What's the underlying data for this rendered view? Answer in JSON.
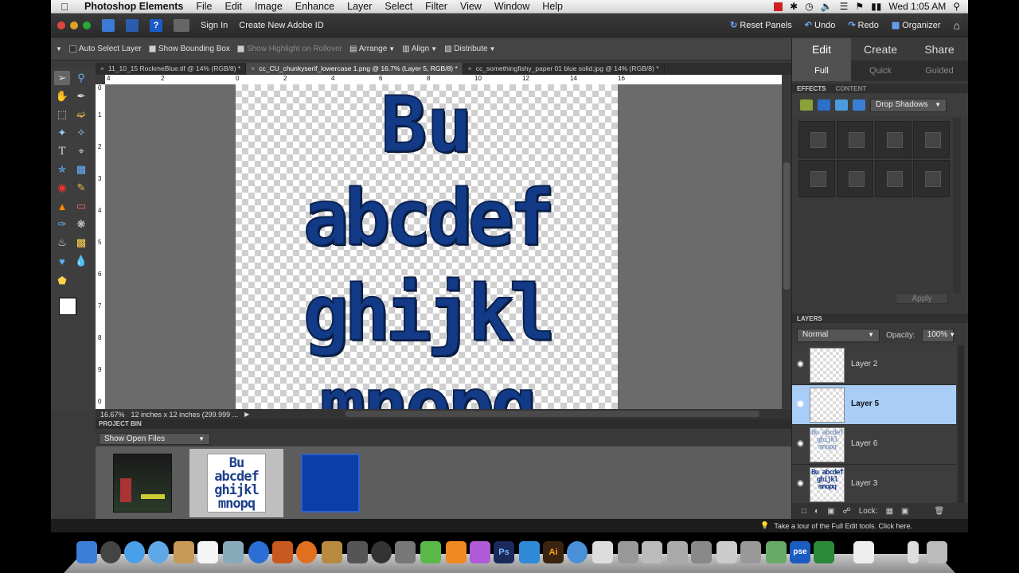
{
  "menubar": {
    "apple": "",
    "items": [
      "Photoshop Elements",
      "File",
      "Edit",
      "Image",
      "Enhance",
      "Layer",
      "Select",
      "Filter",
      "View",
      "Window",
      "Help"
    ],
    "clock": "Wed 1:05 AM",
    "status_icons": [
      "adobe-icon",
      "bluetooth-icon",
      "time-machine-icon",
      "volume-icon",
      "wifi-icon",
      "flag-icon",
      "battery-icon",
      "search-icon"
    ]
  },
  "topbar": {
    "sign_in": "Sign In",
    "create_id": "Create New Adobe ID",
    "reset_panels": "Reset Panels",
    "undo": "Undo",
    "redo": "Redo",
    "organizer": "Organizer"
  },
  "options": {
    "auto_select": "Auto Select Layer",
    "show_bbox": "Show Bounding Box",
    "show_highlight": "Show Highlight on Rollover",
    "arrange": "Arrange",
    "align": "Align",
    "distribute": "Distribute"
  },
  "doc_tabs": [
    {
      "label": "11_10_15 RockmeBlue.tif @ 14% (RGB/8) *",
      "active": false
    },
    {
      "label": "cc_CU_chunkyserif_lowercase 1.png @ 16.7% (Layer 5, RGB/8) *",
      "active": true
    },
    {
      "label": "cc_somethingfishy_paper 01 blue solid.jpg @ 14% (RGB/8) *",
      "active": false
    }
  ],
  "rulers": {
    "top": [
      "4",
      "2",
      "0",
      "2",
      "4",
      "6",
      "8",
      "10",
      "12",
      "14",
      "16"
    ],
    "left": [
      "0",
      "1",
      "2",
      "3",
      "4",
      "5",
      "6",
      "7",
      "8",
      "9",
      "0"
    ]
  },
  "canvas": {
    "lines": [
      "Bu",
      "abcdef",
      "ghijkl",
      "mnopq"
    ]
  },
  "status": {
    "zoom": "16.67%",
    "doc_info": "12 inches x 12 inches (299.999 ..."
  },
  "project_bin": {
    "title": "PROJECT BIN",
    "select": "Show Open Files"
  },
  "modes": {
    "tabs": [
      "Edit",
      "Create",
      "Share"
    ],
    "subtabs": [
      "Full",
      "Quick",
      "Guided"
    ]
  },
  "effects": {
    "tabs": [
      "EFFECTS",
      "CONTENT"
    ],
    "select": "Drop Shadows",
    "apply": "Apply"
  },
  "layers": {
    "title": "LAYERS",
    "blend": "Normal",
    "opacity_label": "Opacity:",
    "opacity_value": "100%",
    "lock_label": "Lock:",
    "items": [
      {
        "name": "Layer 2",
        "selected": false
      },
      {
        "name": "Layer 5",
        "selected": true
      },
      {
        "name": "Layer 6",
        "selected": false
      },
      {
        "name": "Layer 3",
        "selected": false
      }
    ],
    "thumb_text": "Bu abcdef ghijkl mnopq"
  },
  "tip": "Take a tour of the Full Edit tools. Click here."
}
